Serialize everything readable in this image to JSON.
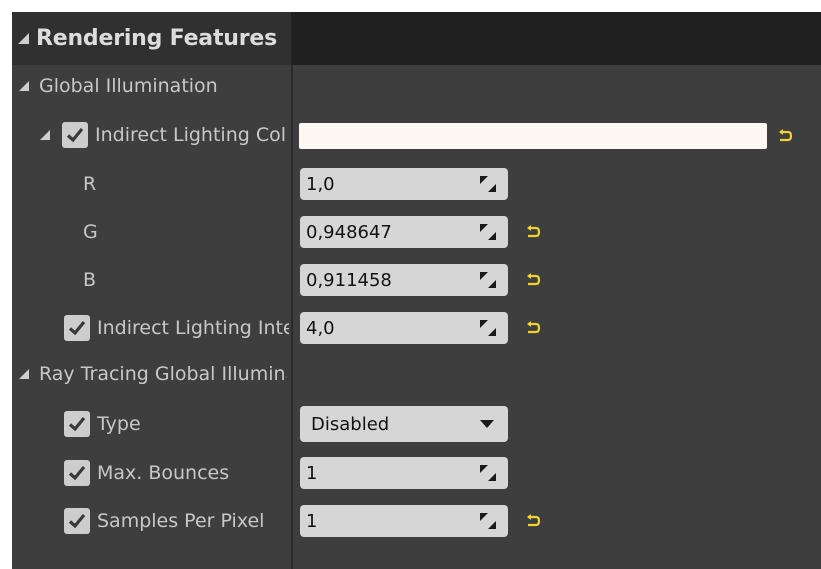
{
  "panel": {
    "title": "Rendering Features"
  },
  "sections": {
    "global_illumination": {
      "label": "Global Illumination",
      "indirect_lighting_color": {
        "label": "Indirect Lighting Color",
        "checked": true,
        "swatch": "#fdf7f1",
        "r": "1,0",
        "g": "0,948647",
        "b": "0,911458",
        "r_label": "R",
        "g_label": "G",
        "b_label": "B"
      },
      "indirect_lighting_intensity": {
        "label": "Indirect Lighting Intensity",
        "checked": true,
        "value": "4,0"
      }
    },
    "ray_tracing_gi": {
      "label": "Ray Tracing Global Illumination",
      "type": {
        "label": "Type",
        "checked": true,
        "value": "Disabled"
      },
      "max_bounces": {
        "label": "Max. Bounces",
        "checked": true,
        "value": "1"
      },
      "samples_per_pixel": {
        "label": "Samples Per Pixel",
        "checked": true,
        "value": "1"
      }
    }
  },
  "colors": {
    "reset_arrow": "#f2d230",
    "background": "#3e3e3e",
    "header": "#202020",
    "field": "#d6d6d6"
  },
  "icons": {
    "expand": "triangle-expanded-icon",
    "check": "checkmark-icon",
    "spin": "drag-spinner-icon",
    "reset": "reset-to-default-icon",
    "dropdown": "chevron-down-icon"
  }
}
